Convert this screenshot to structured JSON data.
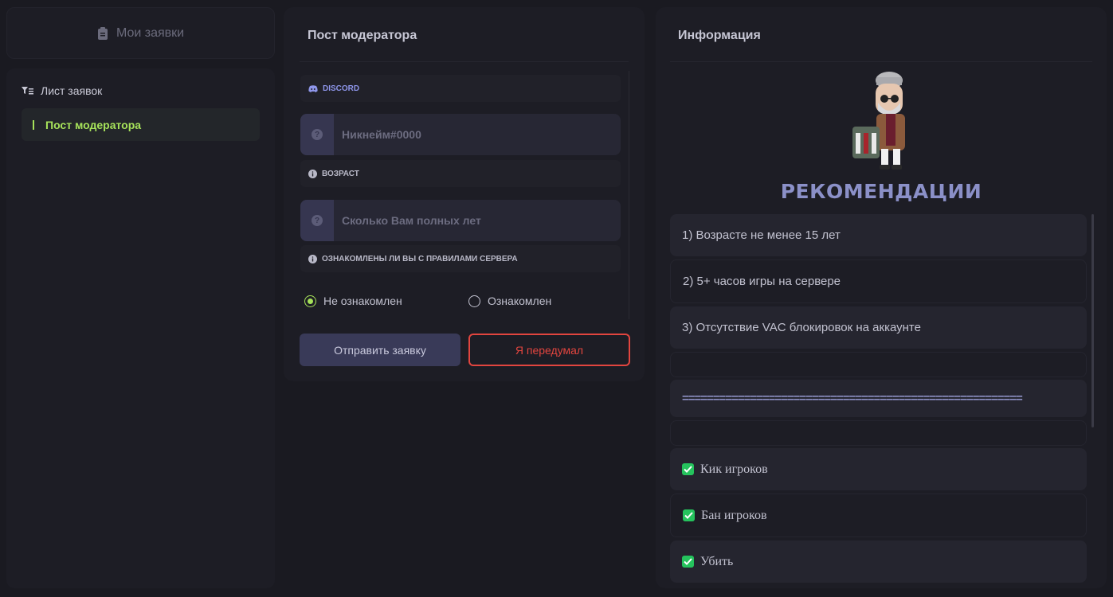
{
  "sidebar": {
    "my_requests": "Мои заявки",
    "list_title": "Лист заявок",
    "items": [
      {
        "label": "Пост модератора",
        "active": true
      }
    ]
  },
  "form": {
    "title": "Пост модератора",
    "discord_label": "DISCORD",
    "discord_placeholder": "Никнейм#0000",
    "age_label": "ВОЗРАСТ",
    "age_placeholder": "Сколько Вам полных лет",
    "rules_label": "ОЗНАКОМЛЕНЫ ЛИ ВЫ С ПРАВИЛАМИ СЕРВЕРА",
    "radio_options": [
      {
        "label": "Не ознакомлен",
        "checked": true
      },
      {
        "label": "Ознакомлен",
        "checked": false
      }
    ],
    "submit_label": "Отправить заявку",
    "cancel_label": "Я передумал"
  },
  "info": {
    "title": "Информация",
    "recommendations_title": "РЕКОМЕНДАЦИИ",
    "items": [
      "1) Возрасте не менее 15 лет",
      "2) 5+ часов игры на сервере",
      "3) Отсутствие VAC блокировок на аккаунте",
      "",
      "=======================================================",
      "",
      "Кик игроков",
      "Бан игроков",
      "Убить"
    ]
  },
  "colors": {
    "accent_green": "#a6e25a",
    "danger_red": "#e2453f",
    "check_green": "#25c35d",
    "title_purple": "#8b90c8"
  }
}
